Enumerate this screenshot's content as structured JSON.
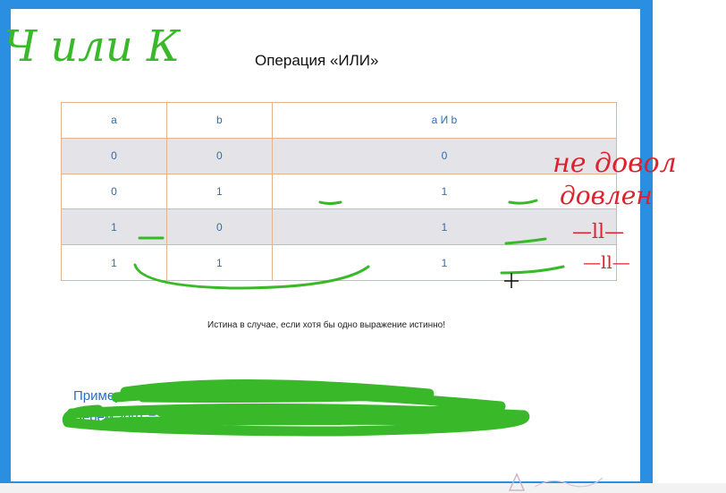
{
  "slide": {
    "title": "Операция «ИЛИ»",
    "table": {
      "headers": [
        "a",
        "b",
        "a И b"
      ],
      "rows": [
        [
          "0",
          "0",
          "0"
        ],
        [
          "0",
          "1",
          "1"
        ],
        [
          "1",
          "0",
          "1"
        ],
        [
          "1",
          "1",
          "1"
        ]
      ]
    },
    "note": "Истина в случае, если хотя бы одно выражение истинно!",
    "example": {
      "line1": "Пример:",
      "line2_start": "Берём зонт = (",
      "line2_or": "ИЛИ",
      "line2_end": ") дождь)"
    }
  },
  "annotations": {
    "title_green": "Ч или К",
    "red_1": "не довол",
    "red_2": "довлен",
    "red_3": "—ll—",
    "red_4": "—ll—",
    "colors": {
      "green": "#39b82a",
      "red": "#e0202e"
    }
  }
}
